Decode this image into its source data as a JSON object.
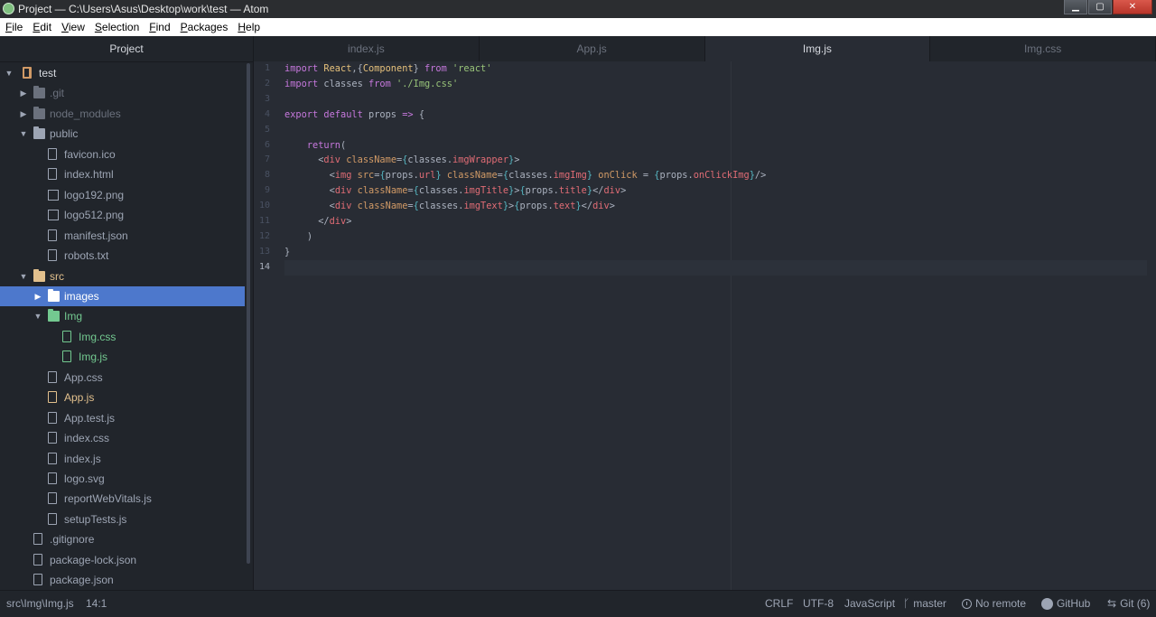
{
  "window": {
    "title": "Project — C:\\Users\\Asus\\Desktop\\work\\test — Atom",
    "min": "0",
    "max": "1",
    "close": "r"
  },
  "menu": [
    "File",
    "Edit",
    "View",
    "Selection",
    "Find",
    "Packages",
    "Help"
  ],
  "tree": {
    "header": "Project",
    "items": [
      {
        "label": "test",
        "icon": "repo-icon",
        "chevron": "down",
        "color": "white"
      },
      {
        "label": ".git",
        "icon": "folder-icon",
        "chevron": "right",
        "color": "dim"
      },
      {
        "label": "node_modules",
        "icon": "folder-icon",
        "chevron": "right",
        "color": "dim"
      },
      {
        "label": "public",
        "icon": "folder-icon",
        "chevron": "down",
        "color": "normal"
      },
      {
        "label": "favicon.ico",
        "icon": "file-icon",
        "color": "normal"
      },
      {
        "label": "index.html",
        "icon": "file-icon",
        "color": "normal"
      },
      {
        "label": "logo192.png",
        "icon": "image-icon",
        "color": "normal"
      },
      {
        "label": "logo512.png",
        "icon": "image-icon",
        "color": "normal"
      },
      {
        "label": "manifest.json",
        "icon": "file-icon",
        "color": "normal"
      },
      {
        "label": "robots.txt",
        "icon": "file-icon",
        "color": "normal"
      },
      {
        "label": "src",
        "icon": "folder-icon",
        "chevron": "down",
        "color": "yellow"
      },
      {
        "label": "images",
        "icon": "folder-icon",
        "chevron": "right",
        "color": "selected"
      },
      {
        "label": "Img",
        "icon": "folder-icon",
        "chevron": "down",
        "color": "green"
      },
      {
        "label": "Img.css",
        "icon": "file-icon",
        "color": "green"
      },
      {
        "label": "Img.js",
        "icon": "file-icon",
        "color": "green"
      },
      {
        "label": "App.css",
        "icon": "file-icon",
        "color": "normal"
      },
      {
        "label": "App.js",
        "icon": "file-icon",
        "color": "yellow"
      },
      {
        "label": "App.test.js",
        "icon": "file-icon",
        "color": "normal"
      },
      {
        "label": "index.css",
        "icon": "file-icon",
        "color": "normal"
      },
      {
        "label": "index.js",
        "icon": "file-icon",
        "color": "normal"
      },
      {
        "label": "logo.svg",
        "icon": "file-icon",
        "color": "normal"
      },
      {
        "label": "reportWebVitals.js",
        "icon": "file-icon",
        "color": "normal"
      },
      {
        "label": "setupTests.js",
        "icon": "file-icon",
        "color": "normal"
      },
      {
        "label": ".gitignore",
        "icon": "file-icon",
        "color": "normal"
      },
      {
        "label": "package-lock.json",
        "icon": "file-icon",
        "color": "normal"
      },
      {
        "label": "package.json",
        "icon": "file-icon",
        "color": "normal"
      }
    ]
  },
  "tabs": [
    {
      "label": "index.js",
      "active": false
    },
    {
      "label": "App.js",
      "active": false
    },
    {
      "label": "Img.js",
      "active": true
    },
    {
      "label": "Img.css",
      "active": false
    }
  ],
  "editor": {
    "line_numbers": [
      "1",
      "2",
      "3",
      "4",
      "5",
      "6",
      "7",
      "8",
      "9",
      "10",
      "11",
      "12",
      "13",
      "14"
    ],
    "lines": [
      [
        [
          "k",
          "import "
        ],
        [
          "v",
          "React"
        ],
        [
          "b",
          ",{"
        ],
        [
          "v",
          "Component"
        ],
        [
          "b",
          "} "
        ],
        [
          "k",
          "from "
        ],
        [
          "s",
          "'react'"
        ]
      ],
      [
        [
          "k",
          "import "
        ],
        [
          "pl",
          "classes "
        ],
        [
          "k",
          "from "
        ],
        [
          "s",
          "'./Img.css'"
        ]
      ],
      [],
      [
        [
          "k",
          "export default "
        ],
        [
          "pl",
          "props "
        ],
        [
          "k",
          "=> "
        ],
        [
          "b",
          "{"
        ]
      ],
      [],
      [
        [
          "pl",
          "    "
        ],
        [
          "k",
          "return"
        ],
        [
          "b",
          "("
        ]
      ],
      [
        [
          "pl",
          "      "
        ],
        [
          "b",
          "<"
        ],
        [
          "t",
          "div "
        ],
        [
          "a",
          "className"
        ],
        [
          "b",
          "="
        ],
        [
          "pu",
          "{"
        ],
        [
          "pl",
          "classes."
        ],
        [
          "p",
          "imgWrapper"
        ],
        [
          "pu",
          "}"
        ],
        [
          "b",
          ">"
        ]
      ],
      [
        [
          "pl",
          "        "
        ],
        [
          "b",
          "<"
        ],
        [
          "t",
          "img "
        ],
        [
          "a",
          "src"
        ],
        [
          "b",
          "="
        ],
        [
          "pu",
          "{"
        ],
        [
          "pl",
          "props."
        ],
        [
          "p",
          "url"
        ],
        [
          "pu",
          "} "
        ],
        [
          "a",
          "className"
        ],
        [
          "b",
          "="
        ],
        [
          "pu",
          "{"
        ],
        [
          "pl",
          "classes."
        ],
        [
          "p",
          "imgImg"
        ],
        [
          "pu",
          "} "
        ],
        [
          "a",
          "onClick "
        ],
        [
          "b",
          "= "
        ],
        [
          "pu",
          "{"
        ],
        [
          "pl",
          "props."
        ],
        [
          "p",
          "onClickImg"
        ],
        [
          "pu",
          "}"
        ],
        [
          "b",
          "/>"
        ]
      ],
      [
        [
          "pl",
          "        "
        ],
        [
          "b",
          "<"
        ],
        [
          "t",
          "div "
        ],
        [
          "a",
          "className"
        ],
        [
          "b",
          "="
        ],
        [
          "pu",
          "{"
        ],
        [
          "pl",
          "classes."
        ],
        [
          "p",
          "imgTitle"
        ],
        [
          "pu",
          "}"
        ],
        [
          "b",
          ">"
        ],
        [
          "pu",
          "{"
        ],
        [
          "pl",
          "props."
        ],
        [
          "p",
          "title"
        ],
        [
          "pu",
          "}"
        ],
        [
          "b",
          "</"
        ],
        [
          "t",
          "div"
        ],
        [
          "b",
          ">"
        ]
      ],
      [
        [
          "pl",
          "        "
        ],
        [
          "b",
          "<"
        ],
        [
          "t",
          "div "
        ],
        [
          "a",
          "className"
        ],
        [
          "b",
          "="
        ],
        [
          "pu",
          "{"
        ],
        [
          "pl",
          "classes."
        ],
        [
          "p",
          "imgText"
        ],
        [
          "pu",
          "}"
        ],
        [
          "b",
          ">"
        ],
        [
          "pu",
          "{"
        ],
        [
          "pl",
          "props."
        ],
        [
          "p",
          "text"
        ],
        [
          "pu",
          "}"
        ],
        [
          "b",
          "</"
        ],
        [
          "t",
          "div"
        ],
        [
          "b",
          ">"
        ]
      ],
      [
        [
          "pl",
          "      "
        ],
        [
          "b",
          "</"
        ],
        [
          "t",
          "div"
        ],
        [
          "b",
          ">"
        ]
      ],
      [
        [
          "pl",
          "    "
        ],
        [
          "b",
          ")"
        ]
      ],
      [
        [
          "b",
          "}"
        ]
      ],
      []
    ],
    "cursor_line": 14
  },
  "status": {
    "path": "src\\Img\\Img.js",
    "position": "14:1",
    "line_ending": "CRLF",
    "encoding": "UTF-8",
    "grammar": "JavaScript",
    "branch": "master",
    "remote": "No remote",
    "github": "GitHub",
    "git": "Git (6)"
  }
}
